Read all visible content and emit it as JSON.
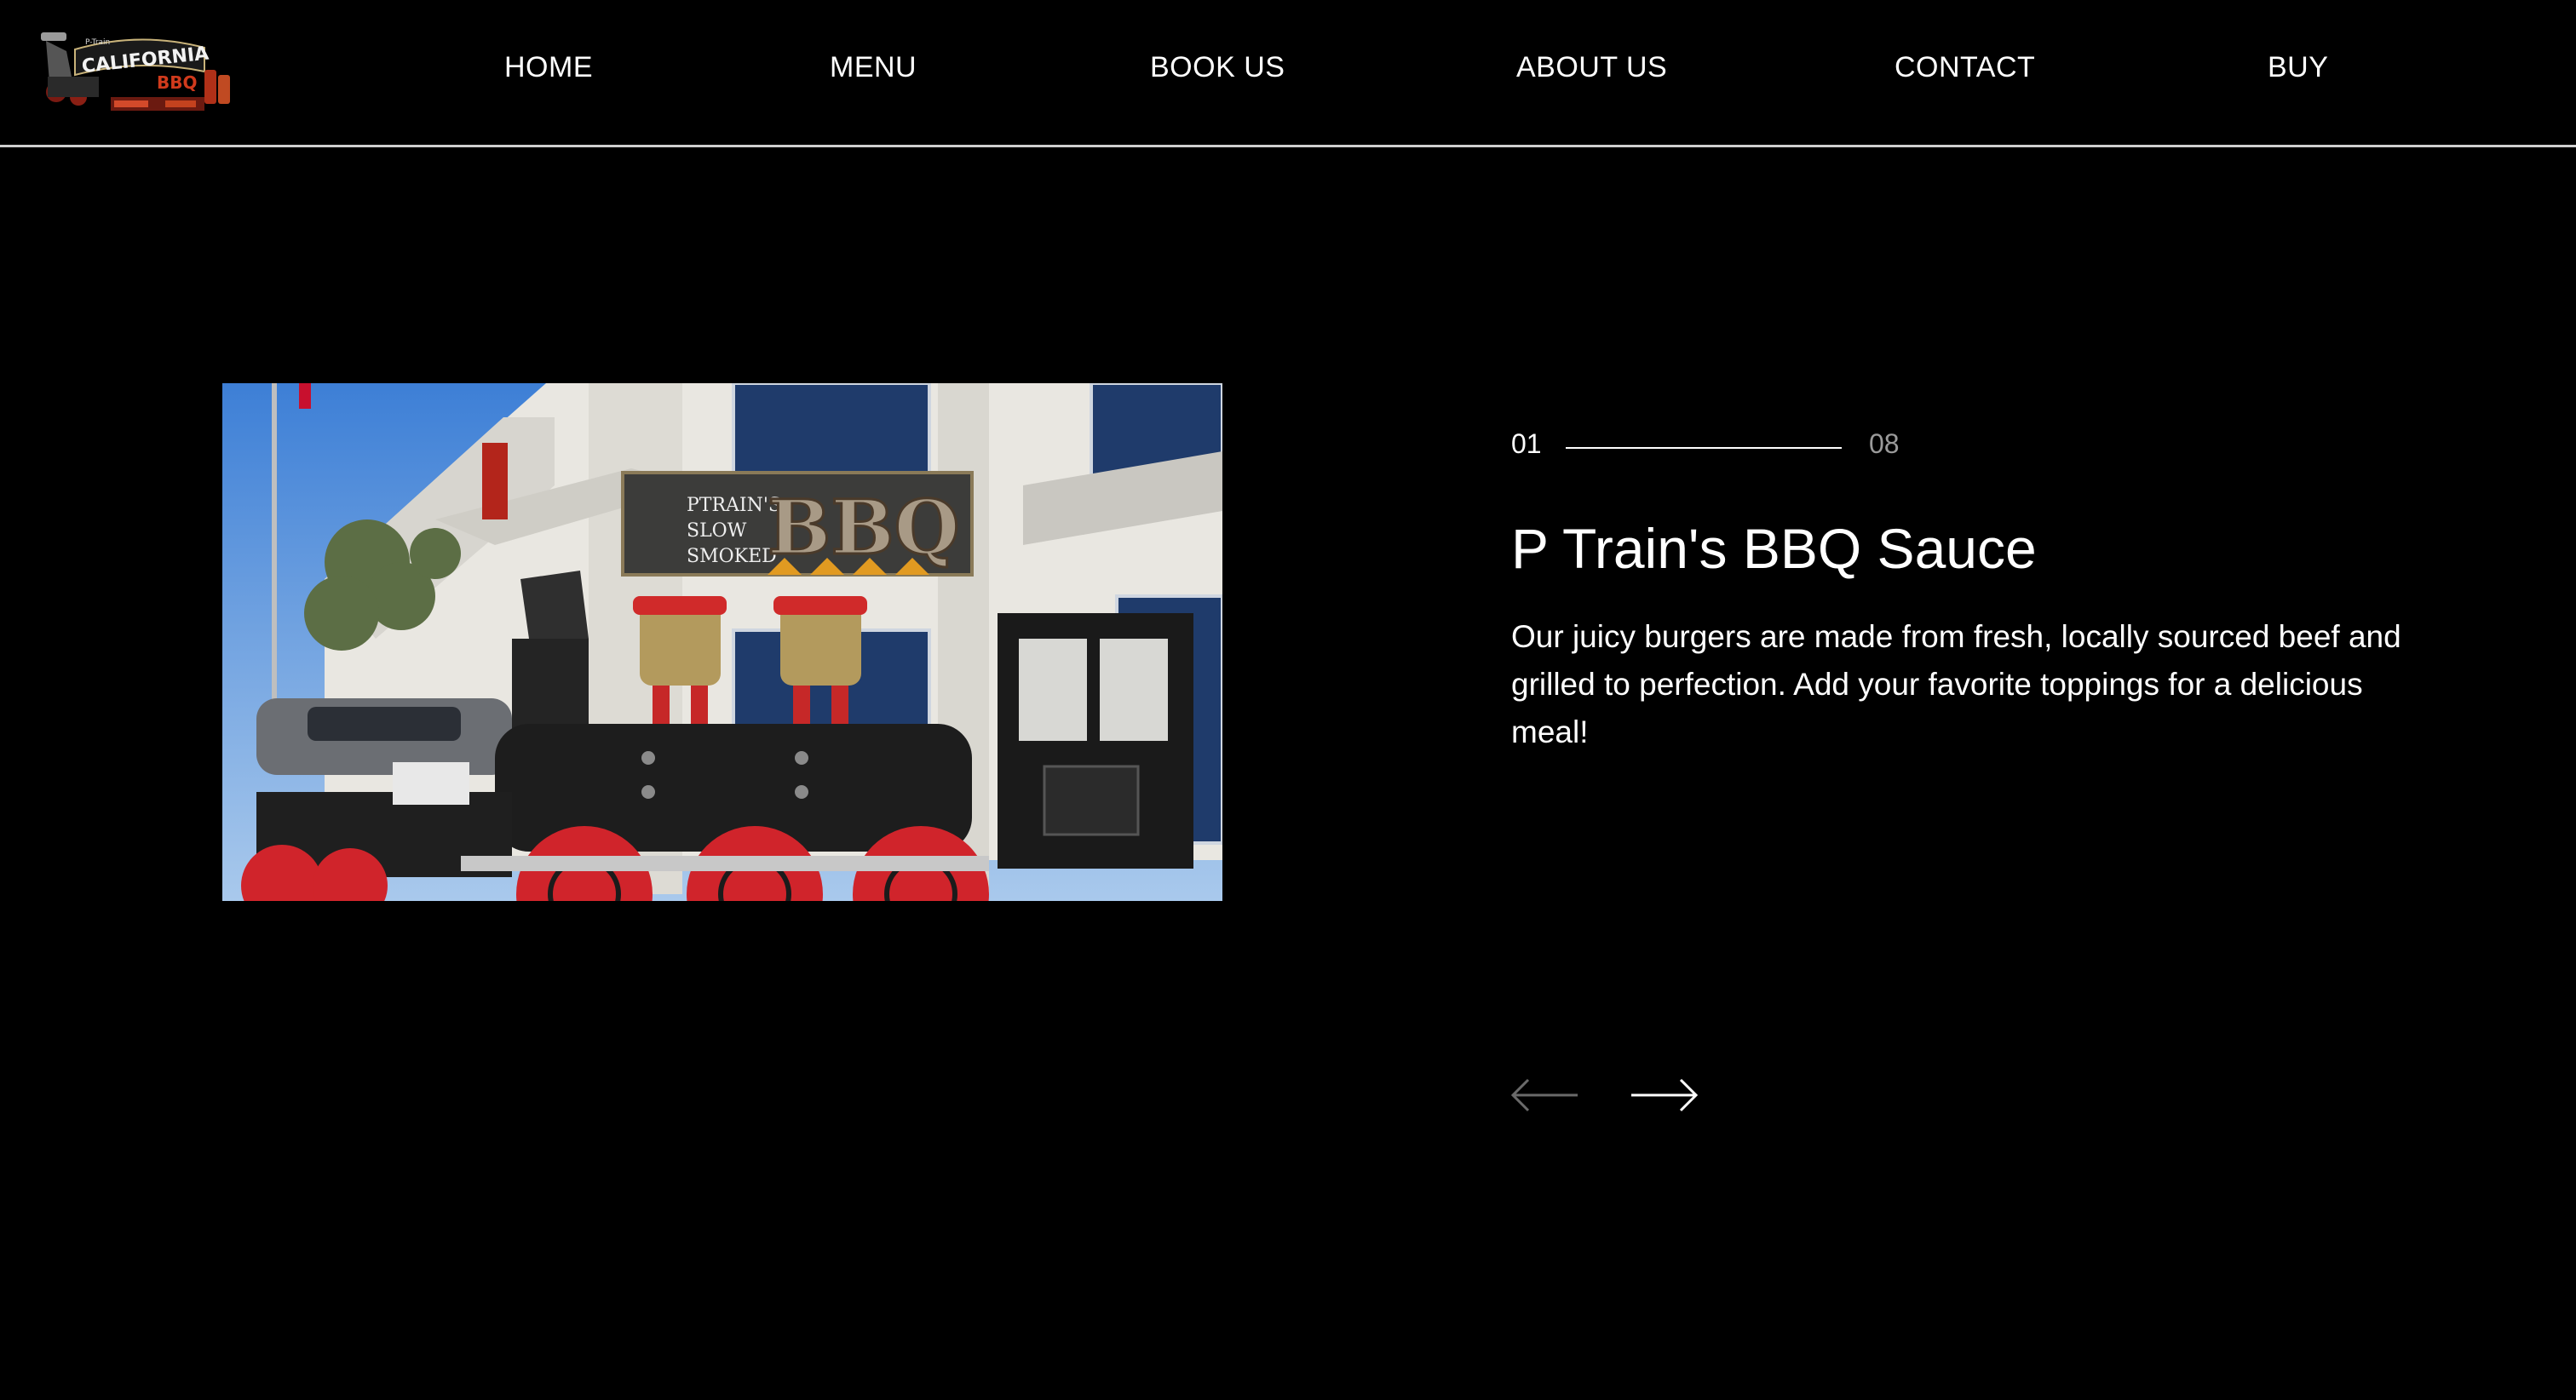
{
  "logo": {
    "text_small": "P-Train",
    "text_main": "CALIFORNIA",
    "text_sub": "BBQ"
  },
  "nav": {
    "items": [
      {
        "label": "HOME"
      },
      {
        "label": "MENU"
      },
      {
        "label": "BOOK US"
      },
      {
        "label": "ABOUT US"
      },
      {
        "label": "CONTACT"
      },
      {
        "label": "BUY"
      }
    ]
  },
  "slider": {
    "current": "01",
    "total": "08",
    "title": "P Train's BBQ Sauce",
    "description": "Our juicy burgers are made from fresh, locally sourced beef and grilled to perfection. Add your favorite toppings for a delicious meal!",
    "image_banner": {
      "line1": "PTRAIN'S",
      "line2": "SLOW",
      "line3": "SMOKED",
      "big": "BBQ"
    },
    "prev_icon": "arrow-left-icon",
    "next_icon": "arrow-right-icon"
  },
  "colors": {
    "background": "#000000",
    "text": "#ffffff",
    "muted": "#9a9a9a",
    "header_border": "#cfcfcf"
  }
}
